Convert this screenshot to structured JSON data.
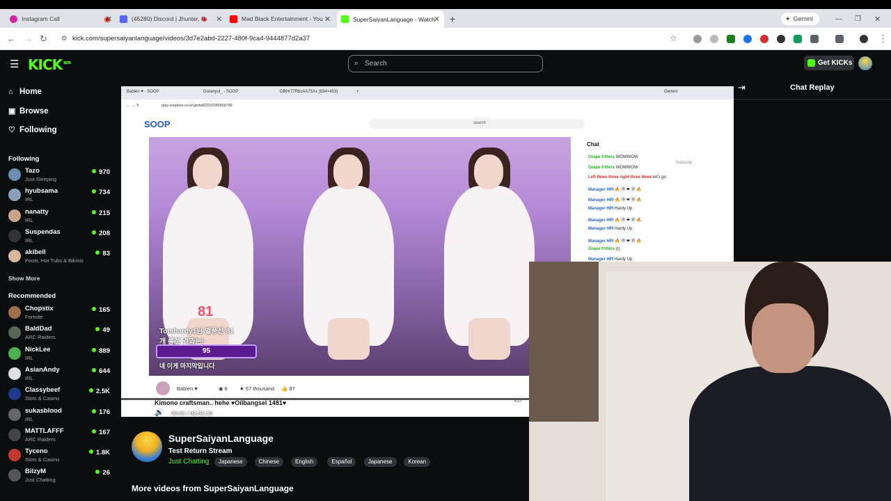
{
  "browser": {
    "tabs": [
      {
        "label": "Instagram Call",
        "active": false
      },
      {
        "label": "(45280) Discord | Jhunter, R",
        "active": false
      },
      {
        "label": "Mad Black Entertainment - You",
        "active": false
      },
      {
        "label": "SuperSaiyanLanguage - Watch",
        "active": true
      }
    ],
    "gemini_label": "Gemini",
    "url": "kick.com/supersaiyanlanguage/videos/3d7e2abd-2227-480f-9ca4-9444877d2a37"
  },
  "header": {
    "logo": "KICK",
    "logo_badge": "BETA",
    "search_placeholder": "Search",
    "get_kicks_label": "Get KICKs"
  },
  "sidebar": {
    "nav": [
      {
        "label": "Home",
        "icon": "home-icon"
      },
      {
        "label": "Browse",
        "icon": "browse-icon"
      },
      {
        "label": "Following",
        "icon": "heart-icon"
      }
    ],
    "following_title": "Following",
    "following": [
      {
        "name": "Tazo",
        "sub": "Just Sleeping",
        "viewers": "970",
        "color": "#6a8fb0"
      },
      {
        "name": "hyubsama",
        "sub": "IRL",
        "viewers": "734",
        "color": "#8aa0b8"
      },
      {
        "name": "nanatty",
        "sub": "IRL",
        "viewers": "215",
        "color": "#c9a48a"
      },
      {
        "name": "Suspendas",
        "sub": "IRL",
        "viewers": "208",
        "color": "#333333"
      },
      {
        "name": "akibell",
        "sub": "Pools, Hot Tubs & Bikinis",
        "viewers": "83",
        "color": "#d7b59e"
      }
    ],
    "show_more_label": "Show More",
    "recommended_title": "Recommended",
    "recommended": [
      {
        "name": "Chopstix",
        "sub": "Fortnite",
        "viewers": "165",
        "color": "#a0704a"
      },
      {
        "name": "BaldDad",
        "sub": "ARC Raiders",
        "viewers": "49",
        "color": "#556655"
      },
      {
        "name": "NickLee",
        "sub": "IRL",
        "viewers": "889",
        "color": "#4caf50"
      },
      {
        "name": "AsianAndy",
        "sub": "IRL",
        "viewers": "644",
        "color": "#e0e0e0"
      },
      {
        "name": "Classybeef",
        "sub": "Slots & Casino",
        "viewers": "2.5K",
        "color": "#1e3a8a"
      },
      {
        "name": "sukasblood",
        "sub": "IRL",
        "viewers": "176",
        "color": "#666666"
      },
      {
        "name": "MATTLAFFF",
        "sub": "ARC Raiders",
        "viewers": "167",
        "color": "#444444"
      },
      {
        "name": "Tyceno",
        "sub": "Slots & Casino",
        "viewers": "1.8K",
        "color": "#c0392b"
      },
      {
        "name": "BilzyM",
        "sub": "Just Chatting",
        "viewers": "26",
        "color": "#555555"
      }
    ]
  },
  "video": {
    "inner_tabs": [
      "Babien ♥ - SOOP",
      "Goranyul_ - SOOP",
      "GBHr77RbcAA75Xx (634×453)"
    ],
    "inner_url": "play.sooplive.co.kr/gmlwl0202/289958796",
    "inner_gemini": "Gemini",
    "soop_logo": "SOOP",
    "inner_search": "search",
    "overlay": {
      "number": "81",
      "line1": "Tomhardy1님 별풍선 81",
      "line2": "개 룰렛 결과는!",
      "bar_value": "95",
      "bottom": "네 이게 마지막입니다"
    },
    "chat_title": "Chat",
    "chat_subscribe": "Subscrip",
    "chat_rows": [
      {
        "user": "Grape fritters",
        "msg": "WOWWOW",
        "kind": "g"
      },
      {
        "user": "Grape fritters",
        "msg": "WOWWOW",
        "kind": "g"
      },
      {
        "user": "Left three three right three three",
        "msg": "let's go",
        "kind": "r"
      },
      {
        "user": "Manager HPI",
        "msg": "🔥 ⑲ ❤ ⑲ 🔥",
        "kind": "u"
      },
      {
        "user": "Manager HPI",
        "msg": "🔥 ⑲ ❤ ⑲ 🔥",
        "kind": "u"
      },
      {
        "user": "Manager HPI",
        "msg": "Hardy Up",
        "kind": "u"
      },
      {
        "user": "Manager HPI",
        "msg": "🔥 ⑲ ❤ ⑲ 🔥",
        "kind": "u"
      },
      {
        "user": "Manager HPI",
        "msg": "Hardy Up",
        "kind": "u"
      },
      {
        "user": "Manager HPI",
        "msg": "🔥 ⑲ ❤ ⑲ 🔥",
        "kind": "u"
      },
      {
        "user": "Grape fritters",
        "msg": "(((",
        "kind": "g"
      },
      {
        "user": "Manager HPI",
        "msg": "Hardy Up",
        "kind": "u"
      }
    ],
    "streamer_name": "Babien.♥",
    "viewers_count": "6",
    "stars": "67 thousand",
    "likes": "87",
    "caption": "Kimono craftsman.. hehe ♥Oilbangsel 1481♥",
    "caption_count": "610",
    "progress": 0.0,
    "timecode": "00:01 / 02:51:40"
  },
  "chat_replay": {
    "title": "Chat Replay"
  },
  "channel": {
    "name": "SuperSaiyanLanguage",
    "stream_title": "Test Return Stream",
    "category": "Just Chatting",
    "tags": [
      "Japanese",
      "Chinese",
      "English",
      "Español",
      "Japanese",
      "Korean"
    ]
  },
  "more_videos_label": "More videos from SuperSaiyanLanguage",
  "colors": {
    "brand": "#53fc18",
    "background": "#0b0e0f"
  }
}
